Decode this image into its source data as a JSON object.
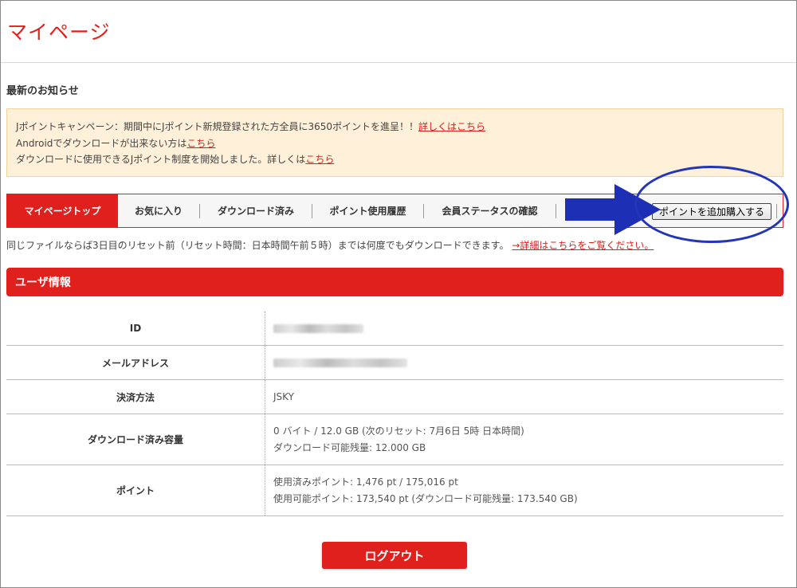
{
  "header": {
    "title": "マイページ"
  },
  "news": {
    "heading": "最新のお知らせ",
    "items": [
      {
        "text": "Jポイントキャンペーン：期間中にJポイント新規登録された方全員に3650ポイントを進呈！！",
        "link": "詳しくはこちら"
      },
      {
        "text": "Androidでダウンロードが出来ない方は",
        "link": "こちら"
      },
      {
        "text": "ダウンロードに使用できるJポイント制度を開始しました。詳しくは",
        "link": "こちら"
      }
    ]
  },
  "tabs": [
    {
      "label": "マイページトップ",
      "active": true
    },
    {
      "label": "お気に入り"
    },
    {
      "label": "ダウンロード済み"
    },
    {
      "label": "ポイント使用履歴"
    },
    {
      "label": "会員ステータスの確認"
    }
  ],
  "buy_button": "ポイントを追加購入する",
  "note": {
    "text": "同じファイルならば3日目のリセット前（リセット時間：日本時間午前５時）までは何度でもダウンロードできます。",
    "link": "→詳細はこちらをご覧ください。"
  },
  "user_info": {
    "heading": "ユーザ情報",
    "rows": [
      {
        "label": "ID",
        "lines": []
      },
      {
        "label": "メールアドレス",
        "lines": []
      },
      {
        "label": "決済方法",
        "lines": [
          "JSKY"
        ]
      },
      {
        "label": "ダウンロード済み容量",
        "lines": [
          "0 バイト / 12.0 GB (次のリセット: 7月6日 5時 日本時間)",
          "ダウンロード可能残量: 12.000 GB"
        ]
      },
      {
        "label": "ポイント",
        "lines": [
          "使用済みポイント: 1,476 pt / 175,016 pt",
          "使用可能ポイント: 173,540 pt (ダウンロード可能残量: 173.540 GB)"
        ]
      }
    ]
  },
  "logout_button": "ログアウト",
  "colors": {
    "accent": "#e0201c",
    "annotation": "#2335b8"
  },
  "annotations": {
    "arrow": "arrow-right-icon",
    "circle": "highlight-circle"
  }
}
